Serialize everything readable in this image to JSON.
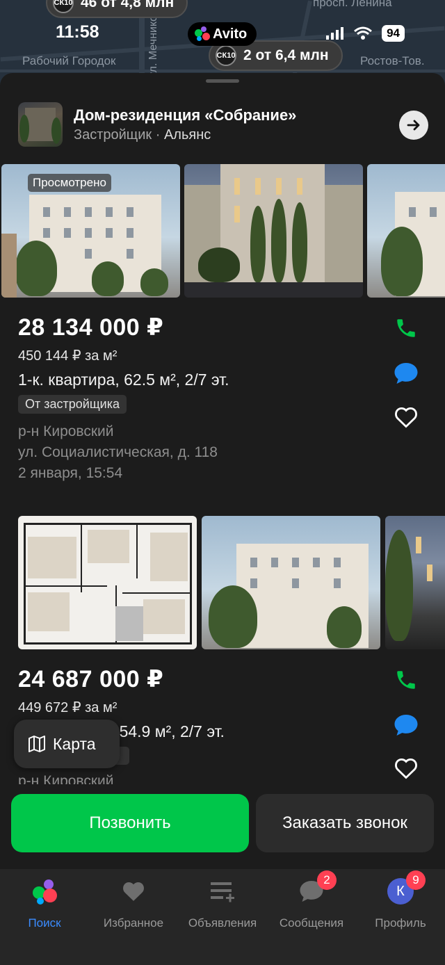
{
  "status_bar": {
    "time": "11:58",
    "app": "Avito",
    "battery": "94"
  },
  "map": {
    "labels": [
      "Рабочий Городок",
      "просп. Ленина",
      "Ростов-Тов.",
      "ул. Мечникова"
    ],
    "pins": [
      {
        "badge": "СК10",
        "text": "46 от 4,8 млн"
      },
      {
        "badge": "СК10",
        "text": "2 от 6,4 млн"
      }
    ]
  },
  "header": {
    "title": "Дом-резиденция «Собрание»",
    "subtitle_prefix": "Застройщик · ",
    "developer": "Альянс"
  },
  "listings": [
    {
      "viewed_label": "Просмотрено",
      "price": "28 134 000 ₽",
      "price_per_sqm": "450 144 ₽ за м²",
      "description": "1-к. квартира, 62.5 м², 2/7 эт.",
      "tag": "От застройщика",
      "district": "р-н Кировский",
      "address": "ул. Социалистическая, д. 118",
      "date": "2 января, 15:54"
    },
    {
      "price": "24 687 000 ₽",
      "price_per_sqm": "449 672 ₽ за м²",
      "description": "а, 54.9 м², 2/7 эт.",
      "district": "р-н Кировский"
    }
  ],
  "map_button": {
    "label": "Карта"
  },
  "cta": {
    "call": "Позвонить",
    "callback": "Заказать звонок"
  },
  "tabbar": {
    "items": [
      {
        "label": "Поиск",
        "icon": "avito-logo-icon"
      },
      {
        "label": "Избранное",
        "icon": "heart-icon"
      },
      {
        "label": "Объявления",
        "icon": "ads-icon"
      },
      {
        "label": "Сообщения",
        "icon": "chat-icon",
        "counter": "2"
      },
      {
        "label": "Профиль",
        "icon": "avatar",
        "avatar_letter": "К",
        "counter": "9"
      }
    ]
  },
  "colors": {
    "accent_green": "#00c64a",
    "active_tab": "#3b8cff",
    "message_blue": "#1e88f0",
    "badge_red": "#ff4053"
  }
}
